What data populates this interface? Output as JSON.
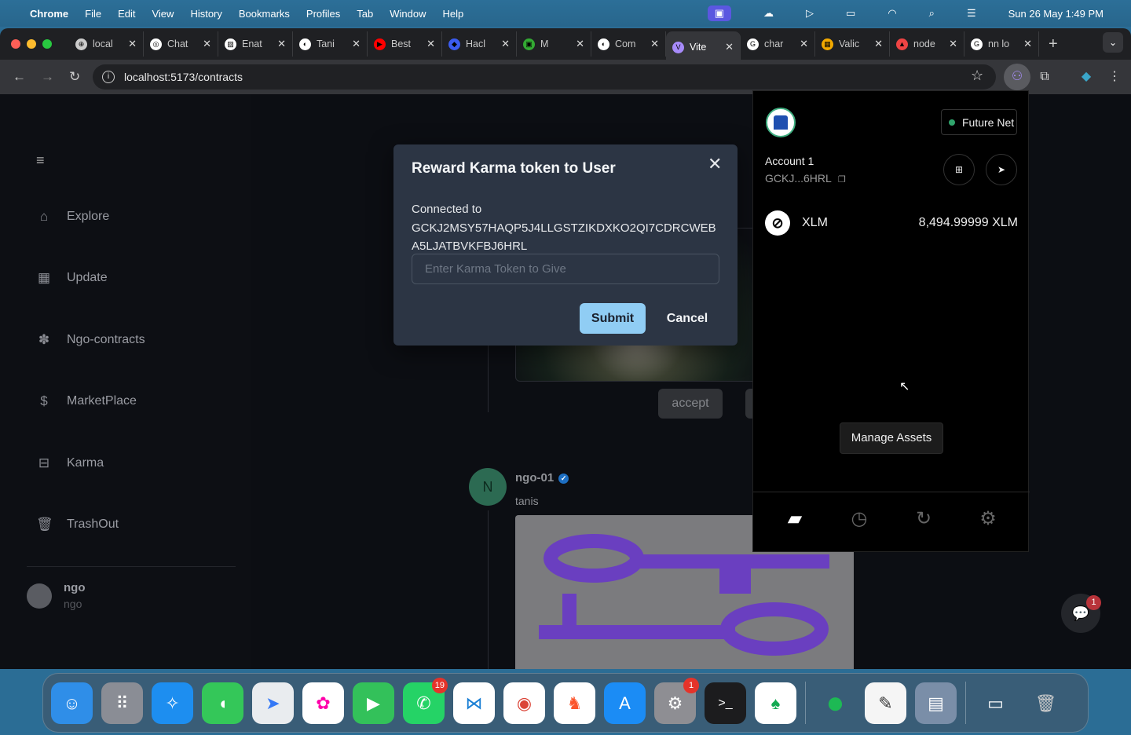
{
  "menubar": {
    "app": "Chrome",
    "items": [
      "File",
      "Edit",
      "View",
      "History",
      "Bookmarks",
      "Profiles",
      "Tab",
      "Window",
      "Help"
    ],
    "datetime": "Sun 26 May  1:49 PM"
  },
  "tabs": [
    {
      "label": "local",
      "active": false
    },
    {
      "label": "Chat",
      "active": false
    },
    {
      "label": "Enat",
      "active": false
    },
    {
      "label": "Tani",
      "active": false
    },
    {
      "label": "Best",
      "active": false
    },
    {
      "label": "Hacl",
      "active": false
    },
    {
      "label": "M",
      "active": false
    },
    {
      "label": "Com",
      "active": false
    },
    {
      "label": "Vite",
      "active": true
    },
    {
      "label": "char",
      "active": false
    },
    {
      "label": "Valic",
      "active": false
    },
    {
      "label": "node",
      "active": false
    },
    {
      "label": "nn lo",
      "active": false
    }
  ],
  "address": {
    "url": "localhost:5173/contracts"
  },
  "sidebar": {
    "items": [
      {
        "label": "Explore",
        "icon": "home-icon"
      },
      {
        "label": "Update",
        "icon": "calendar-icon"
      },
      {
        "label": "Ngo-contracts",
        "icon": "paw-icon"
      },
      {
        "label": "MarketPlace",
        "icon": "dollar-icon"
      },
      {
        "label": "Karma",
        "icon": "briefcase-icon"
      },
      {
        "label": "TrashOut",
        "icon": "trash-icon"
      }
    ],
    "user": {
      "name": "ngo",
      "handle": "ngo"
    }
  },
  "feed": {
    "accept_label": "accept",
    "post": {
      "avatar_letter": "N",
      "author": "ngo-01",
      "text": "tanis"
    }
  },
  "chat": {
    "badge": "1"
  },
  "modal": {
    "title": "Reward Karma token to User",
    "connected_label": "Connected to",
    "address": "GCKJ2MSY57HAQP5J4LLGSTZIKDXKO2QI7CDRCWEBA5LJATBVKFBJ6HRL",
    "input_placeholder": "Enter Karma Token to Give",
    "submit": "Submit",
    "cancel": "Cancel",
    "submit_color": "#90cdf4"
  },
  "wallet": {
    "network": "Future Net",
    "network_color": "#30a46c",
    "account": "Account 1",
    "short_address": "GCKJ...6HRL",
    "assets": [
      {
        "code": "XLM",
        "balance": "8,494.99999 XLM"
      }
    ],
    "manage_label": "Manage Assets"
  },
  "dock": {
    "whatsapp_badge": "19",
    "settings_badge": "1"
  }
}
